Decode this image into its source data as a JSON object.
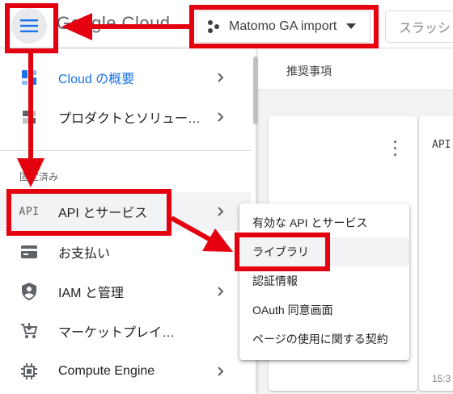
{
  "header": {
    "logo_text": "Google Cloud",
    "project_name": "Matomo GA import",
    "search_placeholder": "スラッシ"
  },
  "main": {
    "tab_label": "推奨事項",
    "card_api_label": "API",
    "card_time": "15:3"
  },
  "sidebar": {
    "pinned_heading": "固定済み",
    "items": [
      {
        "label": "Cloud の概要",
        "icon": "dashboard-icon",
        "active": true
      },
      {
        "label": "プロダクトとソリュー…",
        "icon": "products-grid-icon"
      },
      {
        "label": "API とサービス",
        "icon": "api-icon",
        "icon_text": "API"
      },
      {
        "label": "お支払い",
        "icon": "billing-card-icon"
      },
      {
        "label": "IAM と管理",
        "icon": "security-shield-icon"
      },
      {
        "label": "マーケットプレイ…",
        "icon": "marketplace-cart-icon"
      },
      {
        "label": "Compute Engine",
        "icon": "compute-chip-icon"
      }
    ]
  },
  "submenu": {
    "items": [
      {
        "label": "有効な API とサービス"
      },
      {
        "label": "ライブラリ"
      },
      {
        "label": "認証情報"
      },
      {
        "label": "OAuth 同意画面"
      },
      {
        "label": "ページの使用に関する契約"
      }
    ]
  },
  "colors": {
    "annotation_red": "#e4000f",
    "accent_blue": "#1a73e8"
  }
}
